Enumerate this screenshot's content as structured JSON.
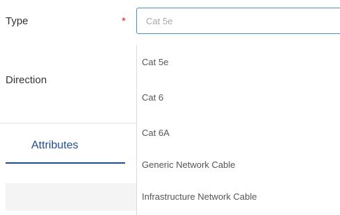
{
  "form": {
    "type_label": "Type",
    "required_mark": "*",
    "type_value": "Cat 5e",
    "direction_label": "Direction"
  },
  "tabs": {
    "attributes_label": "Attributes"
  },
  "dropdown": {
    "options": [
      "Cat 5e",
      "Cat 6",
      "Cat 6A",
      "Generic Network Cable",
      "Infrastructure Network Cable"
    ]
  },
  "colors": {
    "required": "#e02020",
    "input_border": "#4a90c8",
    "tab_accent": "#1f4e8c"
  }
}
